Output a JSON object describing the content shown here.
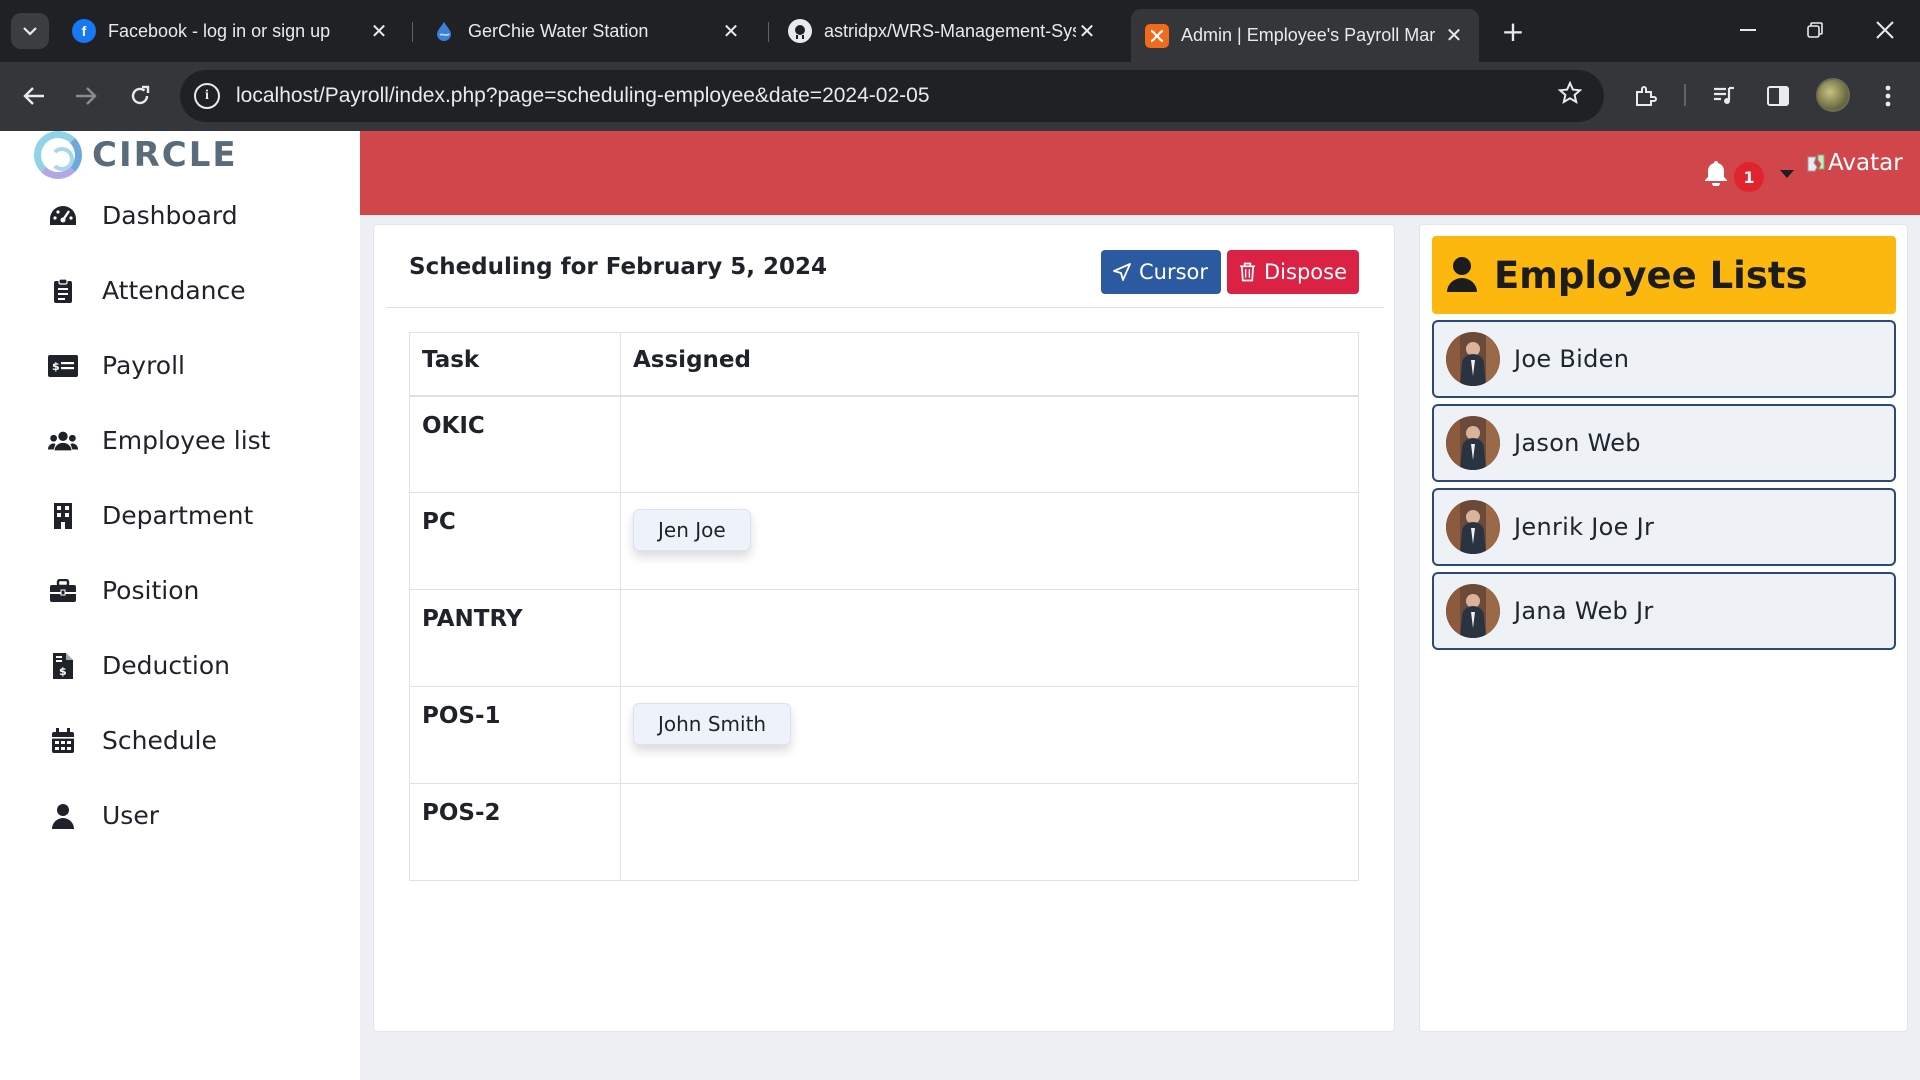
{
  "browser": {
    "tabs": [
      {
        "title": "Facebook - log in or sign up",
        "icon": "facebook-icon"
      },
      {
        "title": "GerChie Water Station",
        "icon": "water-drop-icon"
      },
      {
        "title": "astridpx/WRS-Management-Sys",
        "icon": "github-icon"
      },
      {
        "title": "Admin | Employee's Payroll Mar",
        "icon": "xampp-icon",
        "active": true
      }
    ],
    "url": "localhost/Payroll/index.php?page=scheduling-employee&date=2024-02-05"
  },
  "sidebar": {
    "logo_text": "CIRCLE",
    "items": [
      {
        "label": "Dashboard",
        "icon": "dashboard-icon"
      },
      {
        "label": "Attendance",
        "icon": "clipboard-icon"
      },
      {
        "label": "Payroll",
        "icon": "money-check-icon"
      },
      {
        "label": "Employee list",
        "icon": "users-icon"
      },
      {
        "label": "Department",
        "icon": "building-icon"
      },
      {
        "label": "Position",
        "icon": "briefcase-icon"
      },
      {
        "label": "Deduction",
        "icon": "invoice-dollar-icon"
      },
      {
        "label": "Schedule",
        "icon": "calendar-icon"
      },
      {
        "label": "User",
        "icon": "user-icon"
      }
    ]
  },
  "header": {
    "notification_count": "1",
    "avatar_alt": "Avatar"
  },
  "main": {
    "title": "Scheduling for February 5, 2024",
    "cursor_label": "Cursor",
    "dispose_label": "Dispose",
    "columns": [
      "Task",
      "Assigned"
    ],
    "rows": [
      {
        "task": "OKIC",
        "assigned": ""
      },
      {
        "task": "PC",
        "assigned": "Jen Joe"
      },
      {
        "task": "PANTRY",
        "assigned": ""
      },
      {
        "task": "POS-1",
        "assigned": "John Smith"
      },
      {
        "task": "POS-2",
        "assigned": ""
      }
    ]
  },
  "employees": {
    "title": "Employee Lists",
    "list": [
      "Joe Biden",
      "Jason Web",
      "Jenrik Joe Jr",
      "Jana Web Jr"
    ]
  },
  "colors": {
    "header": "#d0464a",
    "panel_head": "#fcb80e",
    "cursor_button": "#2c5aa0",
    "dispose_button": "#db2144"
  }
}
